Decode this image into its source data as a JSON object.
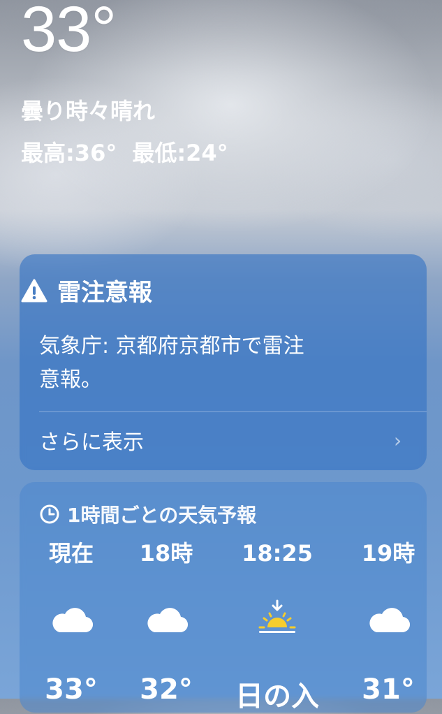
{
  "current": {
    "temperature": "33°",
    "condition": "曇り時々晴れ",
    "high": "最高:36°",
    "low": "最低:24°"
  },
  "alert": {
    "title": "雷注意報",
    "body_line1": "気象庁: 京都府京都市で雷注",
    "body_line2": "意報。",
    "more_label": "さらに表示",
    "icon": "warning-triangle-icon"
  },
  "hourly": {
    "heading": "1時間ごとの天気予報",
    "icon": "clock-icon",
    "items": [
      {
        "time": "現在",
        "icon": "cloud-icon",
        "value": "33°"
      },
      {
        "time": "18時",
        "icon": "cloud-icon",
        "value": "32°"
      },
      {
        "time": "18:25",
        "icon": "sunset-icon",
        "value": "日の入"
      },
      {
        "time": "19時",
        "icon": "cloud-icon",
        "value": "31°"
      }
    ]
  },
  "colors": {
    "sunset_icon": "#f6cd2d",
    "text": "#ffffff"
  }
}
